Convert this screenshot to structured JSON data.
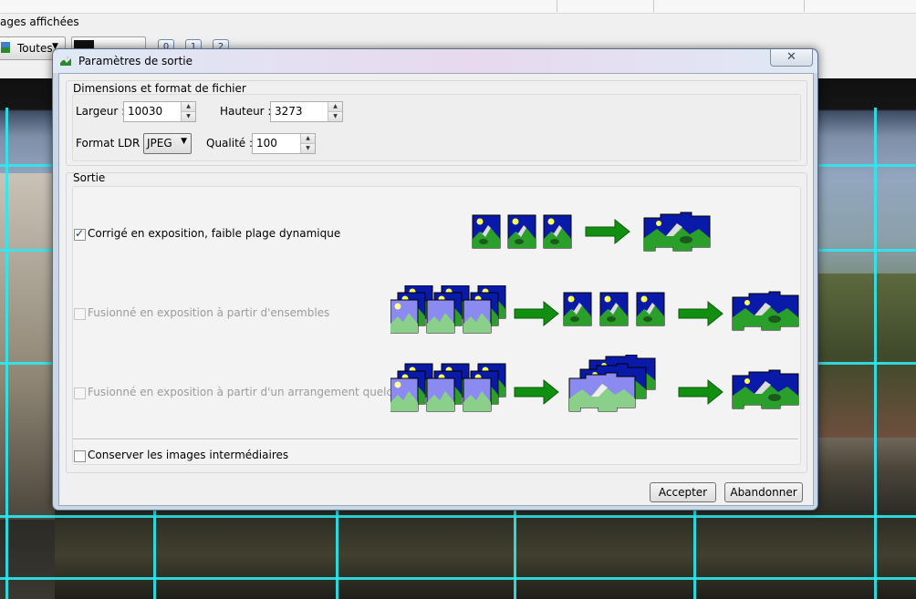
{
  "app": {
    "label": "ages affichées",
    "filter_value": "Toutes",
    "image_buttons": [
      "0",
      "1",
      "2"
    ]
  },
  "dialog": {
    "title": "Paramètres de sortie",
    "close_label": "✕",
    "dimensions": {
      "group_title": "Dimensions et format de fichier",
      "width_label": "Largeur :",
      "width_value": "10030",
      "height_label": "Hauteur :",
      "height_value": "3273",
      "format_label": "Format LDR :",
      "format_value": "JPEG",
      "quality_label": "Qualité :",
      "quality_value": "100"
    },
    "output": {
      "group_title": "Sortie",
      "options": [
        {
          "label": "Corrigé en exposition, faible plage dynamique",
          "checked": true,
          "enabled": true
        },
        {
          "label": "Fusionné en exposition à partir d'ensembles",
          "checked": false,
          "enabled": false
        },
        {
          "label": "Fusionné en exposition à partir d'un arrangement quelconque",
          "checked": false,
          "enabled": false
        }
      ],
      "keep_intermediate": {
        "label": "Conserver les images intermédiaires",
        "checked": false
      }
    },
    "buttons": {
      "accept": "Accepter",
      "cancel": "Abandonner"
    }
  },
  "colors": {
    "sky": "#0a1aa8",
    "grass": "#2aa02a",
    "sun": "#ffff55",
    "arrow": "#118f11",
    "grid": "#2fe8f0"
  }
}
